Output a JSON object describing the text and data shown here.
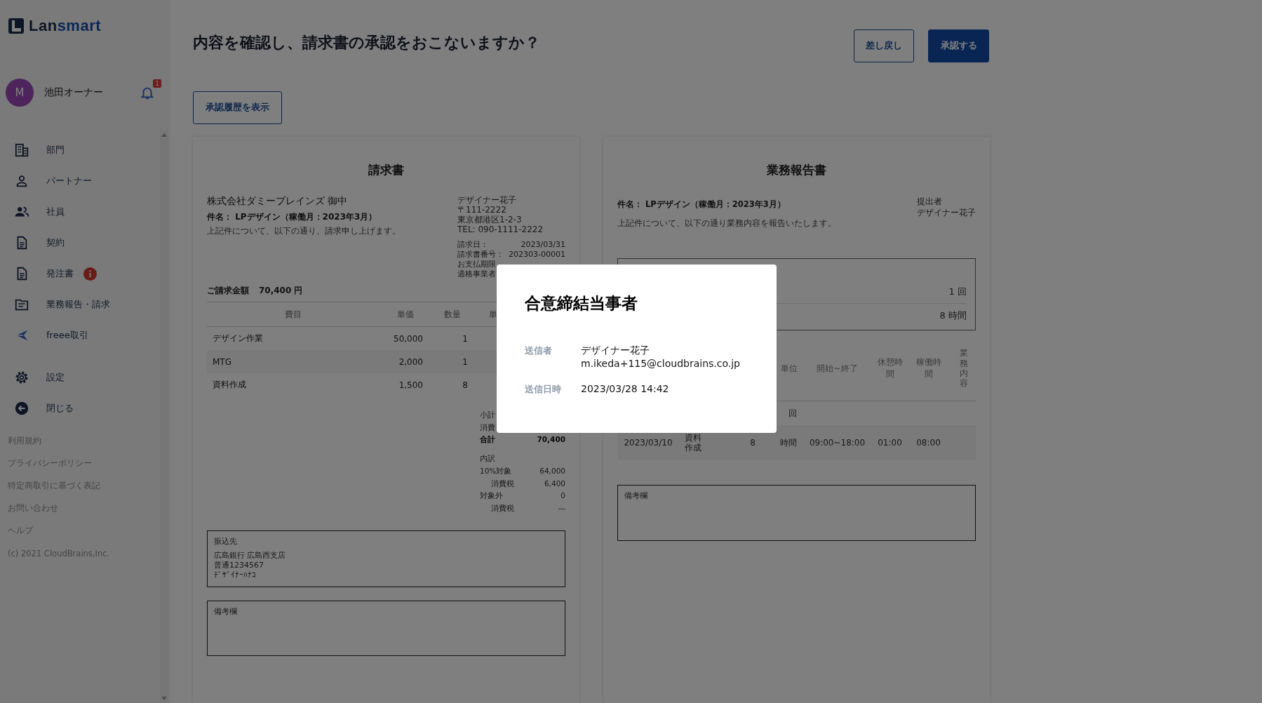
{
  "logo": {
    "prefix": "Lan",
    "suffix": "smart"
  },
  "user": {
    "avatar": "M",
    "name": "池田オーナー",
    "notification_count": "1"
  },
  "nav": [
    {
      "label": "部門",
      "alert": false
    },
    {
      "label": "パートナー",
      "alert": false
    },
    {
      "label": "社員",
      "alert": false
    },
    {
      "label": "契約",
      "alert": false
    },
    {
      "label": "発注書",
      "alert": true
    },
    {
      "label": "業務報告・請求",
      "alert": false
    },
    {
      "label": "freee取引",
      "alert": false
    }
  ],
  "settings_nav": [
    {
      "label": "設定"
    },
    {
      "label": "閉じる"
    }
  ],
  "footer_links": [
    "利用規約",
    "プライバシーポリシー",
    "特定商取引に基づく表記",
    "お問い合わせ",
    "ヘルプ"
  ],
  "copyright": "(c) 2021 CloudBrains,Inc.",
  "page_title": "内容を確認し、請求書の承認をおこないますか？",
  "actions": [
    {
      "label": "差し戻し",
      "kind": "secondary"
    },
    {
      "label": "承認する",
      "kind": "primary"
    }
  ],
  "history_button": "承認履歴を表示",
  "invoice": {
    "title": "請求書",
    "recipient": "株式会社ダミーブレインズ 御中",
    "subject": "件名： LPデザイン（稼働月：2023年3月）",
    "intro": "上記件について、以下の通り、請求申し上げます。",
    "issuer": [
      "デザイナー花子",
      "〒111-2222",
      "東京都港区1-2-3",
      "TEL: 090-1111-2222"
    ],
    "details": [
      {
        "label": "請求日：",
        "value": "2023/03/31"
      },
      {
        "label": "請求書番号：",
        "value": "202303-00001"
      },
      {
        "label": "お支払期限"
      },
      {
        "label": "適格事業者"
      }
    ],
    "amount_label": "ご請求金額",
    "amount": "70,400 円",
    "columns": [
      "費目",
      "単価",
      "数量",
      "単"
    ],
    "rows": [
      {
        "cells": [
          "デザイン作業",
          "50,000",
          "1"
        ]
      },
      {
        "cells": [
          "MTG",
          "2,000",
          "1"
        ]
      },
      {
        "cells": [
          "資料作成",
          "1,500",
          "8"
        ]
      }
    ],
    "totals": [
      {
        "label": "小計",
        "kind": "plain"
      },
      {
        "label": "消費",
        "kind": "plain"
      },
      {
        "label": "合計",
        "value": "70,400",
        "kind": "total"
      },
      {
        "label": "内訳",
        "kind": "heading"
      },
      {
        "label": "10%対象",
        "value": "64,000",
        "kind": "plain"
      },
      {
        "label": "消費税",
        "value": "6,400",
        "kind": "sub"
      },
      {
        "label": "対象外",
        "value": "0",
        "kind": "plain"
      },
      {
        "label": "消費税",
        "value": "—",
        "kind": "sub"
      }
    ],
    "bank": {
      "label": "振込先",
      "lines": [
        "広島銀行 広島西支店",
        "普通1234567",
        "ﾃﾞｻﾞｲﾅｰﾊﾅｺ"
      ]
    },
    "remarks_label": "備考欄"
  },
  "report": {
    "title": "業務報告書",
    "subject": "件名： LPデザイン（稼働月：2023年3月）",
    "intro": "上記件について、以下の通り業務内容を報告いたします。",
    "submitter_label": "提出者",
    "submitter": "デザイナー花子",
    "summary": [
      "1 回",
      "8 時間"
    ],
    "columns": {
      "unit": "単位",
      "time": "開始~終了",
      "break": "休憩時間",
      "work": "稼働時間",
      "content": "業務内容"
    },
    "rows": [
      {
        "unit": "回"
      },
      {
        "date": "2023/03/10",
        "item": "資料作成",
        "quantity": "8",
        "unit": "時間",
        "time": "09:00~18:00",
        "break": "01:00",
        "work": "08:00"
      }
    ],
    "remarks_label": "備考欄"
  },
  "modal": {
    "title": "合意締結当事者",
    "rows": [
      {
        "label": "送信者",
        "lines": [
          "デザイナー花子",
          "m.ikeda+115@cloudbrains.co.jp"
        ]
      },
      {
        "label": "送信日時",
        "lines": [
          "2023/03/28 14:42"
        ]
      }
    ]
  }
}
